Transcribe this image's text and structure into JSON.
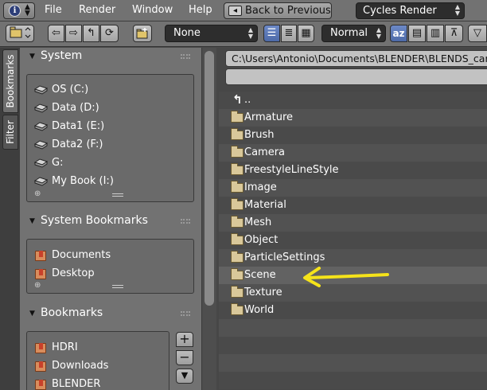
{
  "menu": {
    "items": [
      "File",
      "Render",
      "Window",
      "Help"
    ],
    "back_button": "Back to Previous",
    "render_engine": "Cycles Render"
  },
  "toolbar": {
    "filter_value": "None",
    "display_size": "Normal",
    "sort_label": "az"
  },
  "tabs": [
    "Bookmarks",
    "Filter"
  ],
  "sidebar": {
    "system": {
      "title": "System",
      "items": [
        "OS (C:)",
        "Data (D:)",
        "Data1 (E:)",
        "Data2 (F:)",
        "G:",
        "My Book (I:)"
      ]
    },
    "system_bookmarks": {
      "title": "System Bookmarks",
      "items": [
        "Documents",
        "Desktop"
      ]
    },
    "bookmarks": {
      "title": "Bookmarks",
      "items": [
        "HDRI",
        "Downloads",
        "BLENDER"
      ]
    }
  },
  "browser": {
    "path": "C:\\Users\\Antonio\\Documents\\BLENDER\\BLENDS_carp",
    "filename": "",
    "parent_label": "..",
    "folders": [
      "Armature",
      "Brush",
      "Camera",
      "FreestyleLineStyle",
      "Image",
      "Material",
      "Mesh",
      "Object",
      "ParticleSettings",
      "Scene",
      "Texture",
      "World"
    ],
    "highlighted": "Scene"
  },
  "colors": {
    "annotation_arrow": "#f5e31a",
    "active_button": "#5a78b8"
  }
}
